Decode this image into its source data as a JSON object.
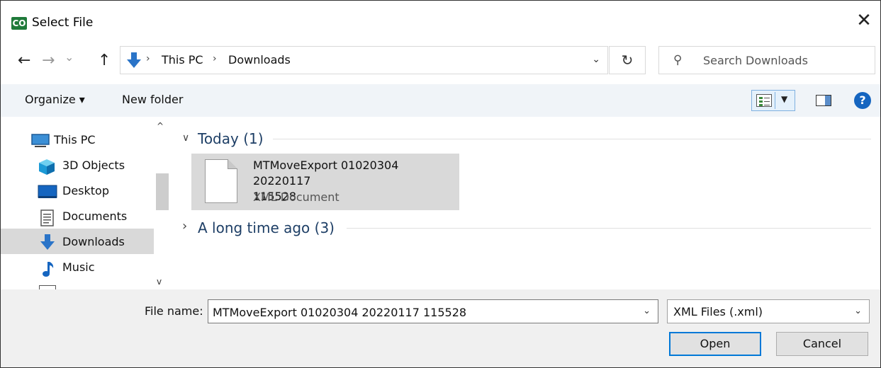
{
  "window": {
    "title": "Select File",
    "app_icon_text": "CO",
    "close_glyph": "✕"
  },
  "nav": {
    "back_glyph": "←",
    "forward_glyph": "→",
    "recent_glyph": "⌄",
    "up_glyph": "↑",
    "breadcrumb": [
      "This PC",
      "Downloads"
    ],
    "crumb_separator": "›",
    "address_dropdown_glyph": "⌄",
    "refresh_glyph": "↻",
    "search_placeholder": "Search Downloads",
    "search_glyph": "⚲"
  },
  "toolbar": {
    "organize_label": "Organize ▾",
    "new_folder_label": "New folder",
    "view_dropdown_glyph": "▼",
    "help_glyph": "?"
  },
  "sidebar": {
    "scroll_up_glyph": "^",
    "scroll_down_glyph": "v",
    "items": [
      {
        "label": "This PC",
        "icon": "computer-icon"
      },
      {
        "label": "3D Objects",
        "icon": "cube-icon"
      },
      {
        "label": "Desktop",
        "icon": "desktop-icon"
      },
      {
        "label": "Documents",
        "icon": "document-icon"
      },
      {
        "label": "Downloads",
        "icon": "download-arrow-icon",
        "selected": true
      },
      {
        "label": "Music",
        "icon": "music-note-icon"
      }
    ]
  },
  "content": {
    "groups": [
      {
        "label": "Today (1)",
        "expanded": true,
        "chevron": "∨"
      },
      {
        "label": "A long time ago (3)",
        "expanded": false,
        "chevron": "›"
      }
    ],
    "files": [
      {
        "name_line1": "MTMoveExport 01020304 20220117",
        "name_line2": "115528",
        "type": "XML Document"
      }
    ]
  },
  "footer": {
    "file_name_label": "File name:",
    "file_name_value": "MTMoveExport 01020304 20220117 115528",
    "file_name_dropdown_glyph": "⌄",
    "file_type_value": "XML Files (.xml)",
    "file_type_dropdown_glyph": "⌄",
    "open_label": "Open",
    "cancel_label": "Cancel"
  },
  "colors": {
    "accent": "#0078d7",
    "selection": "#d9d9d9",
    "group_header": "#1e3f66",
    "toolbar_bg": "#f0f4f8",
    "footer_bg": "#f0f0f0"
  }
}
